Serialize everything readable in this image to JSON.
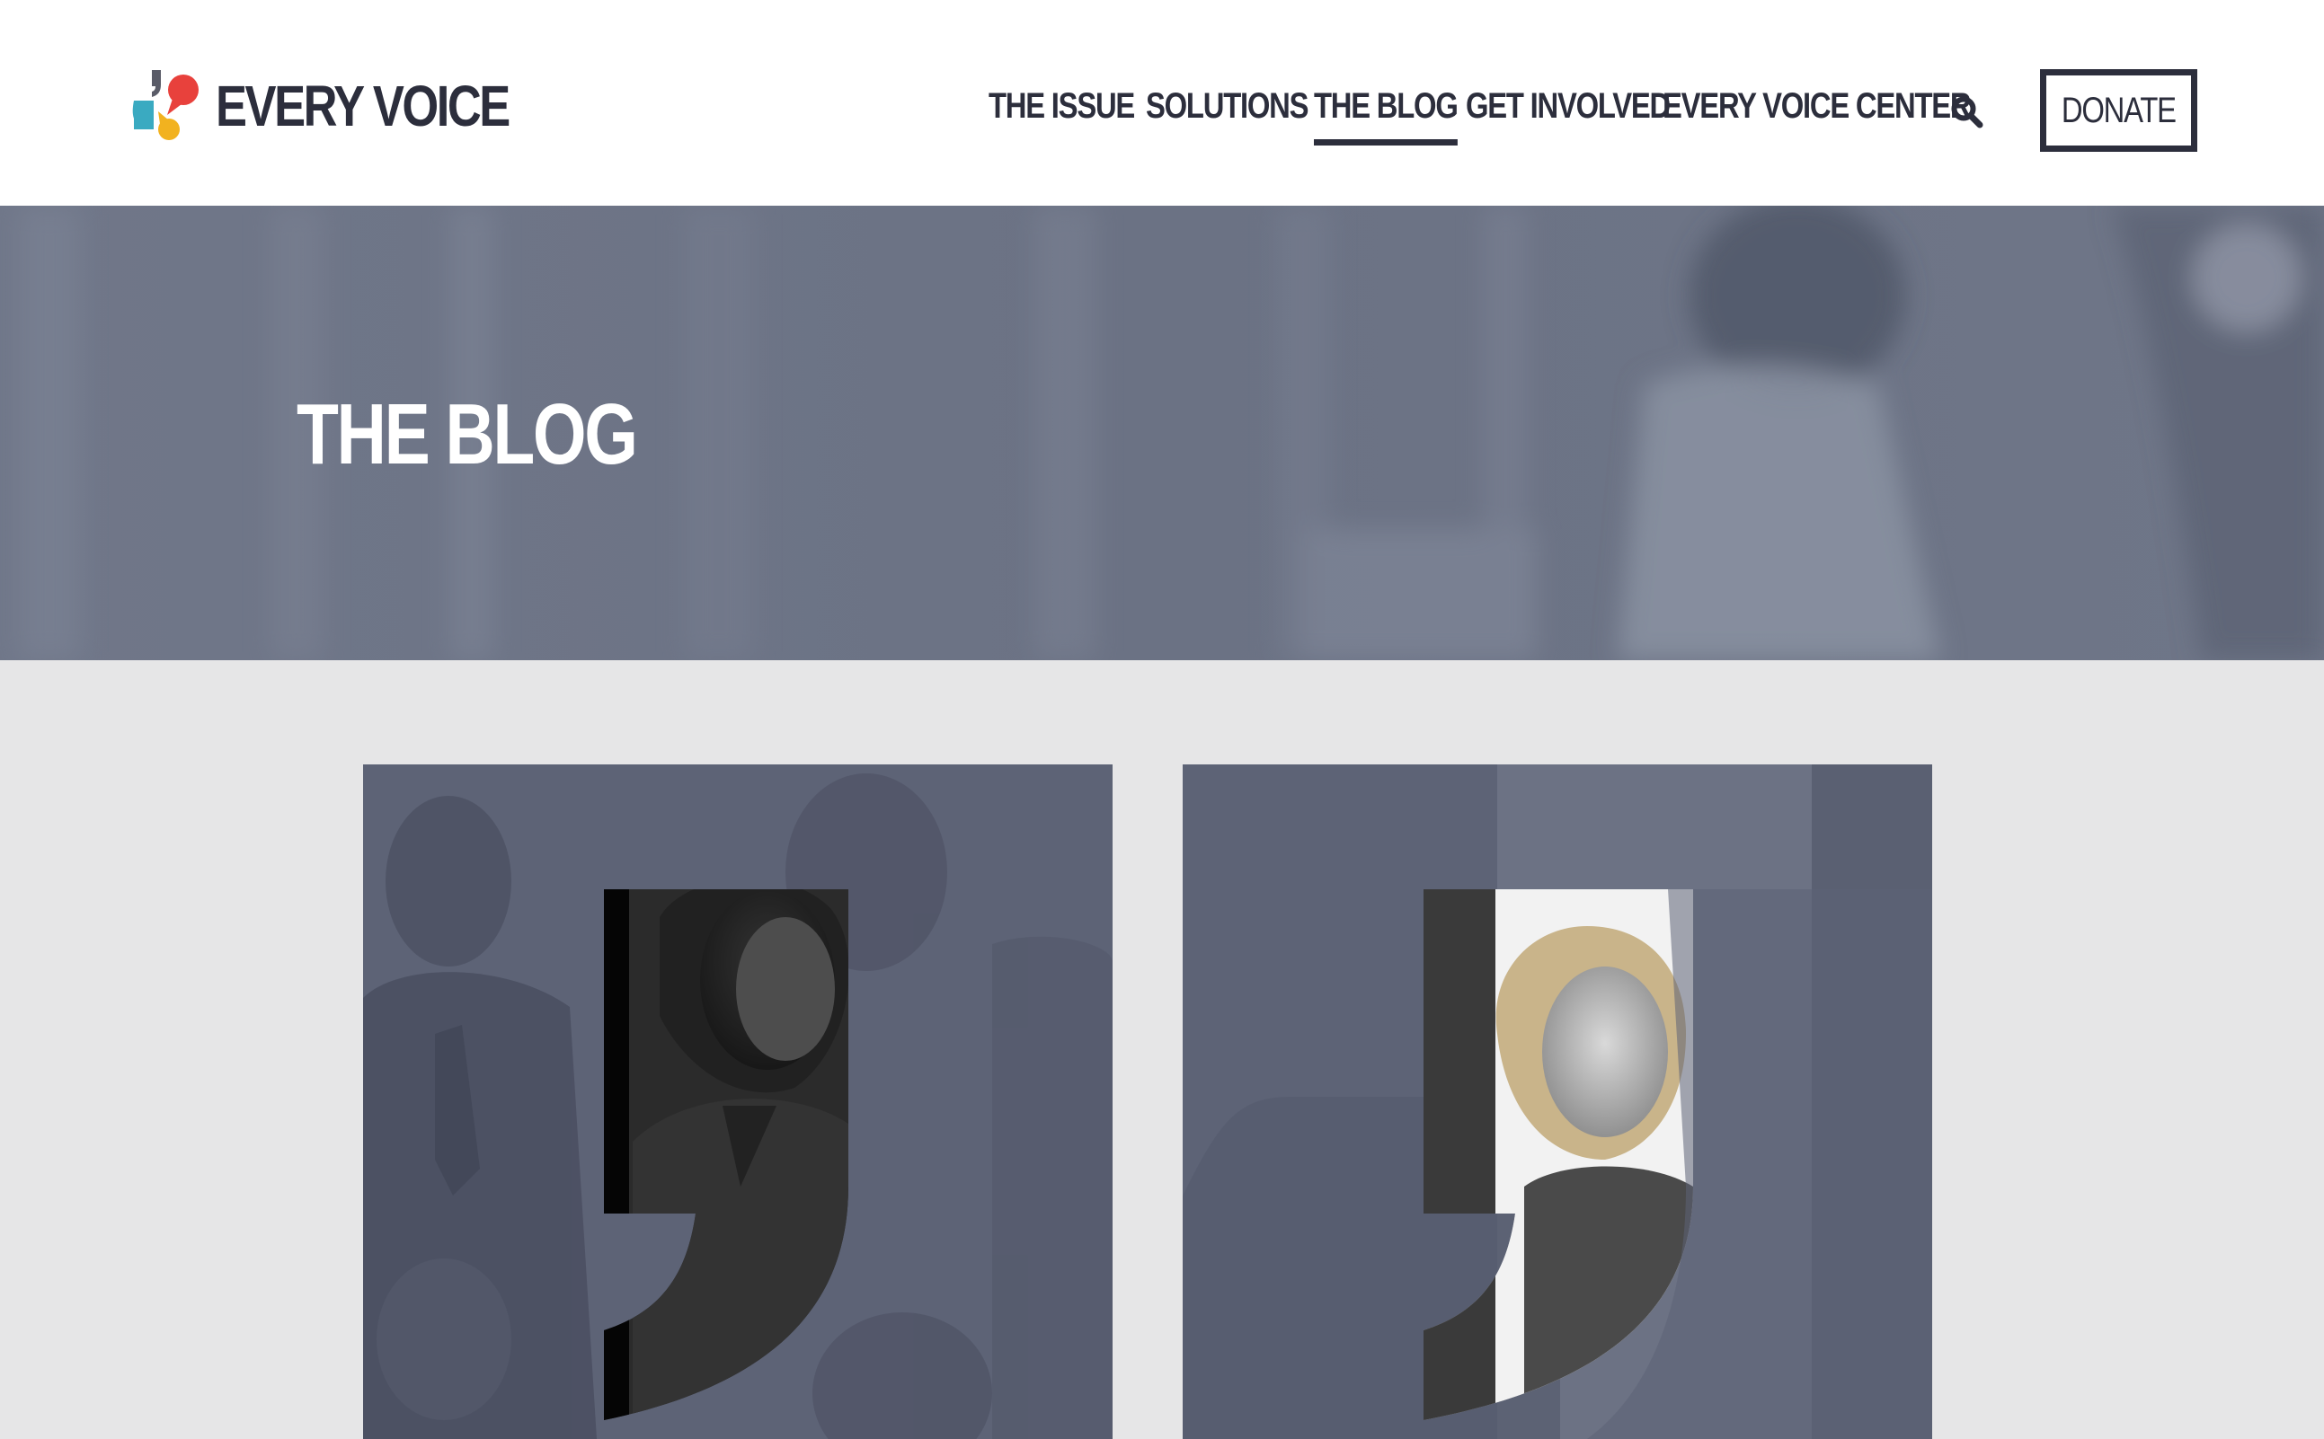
{
  "brand": {
    "name": "EVERY VOICE",
    "colors": {
      "dark": "#2c2e3c",
      "teal": "#3aaac1",
      "red": "#e8413c",
      "yellow": "#f2b21f",
      "gray": "#5a5c68"
    }
  },
  "nav": {
    "items": [
      {
        "label": "THE ISSUE",
        "active": false
      },
      {
        "label": "SOLUTIONS",
        "active": false
      },
      {
        "label": "THE BLOG",
        "active": true
      },
      {
        "label": "GET INVOLVED",
        "active": false
      },
      {
        "label": "EVERY VOICE CENTER",
        "active": false
      }
    ],
    "search_icon": "search-icon",
    "donate_label": "DONATE"
  },
  "hero": {
    "title": "THE BLOG",
    "overlay_color": "#6e7587"
  },
  "posts": [
    {
      "image": "woman-portrait-in-quote-mark",
      "overlay_color": "#5d6376"
    },
    {
      "image": "hillary-clinton-portrait-in-quote-mark",
      "overlay_color": "#5d6376"
    }
  ]
}
